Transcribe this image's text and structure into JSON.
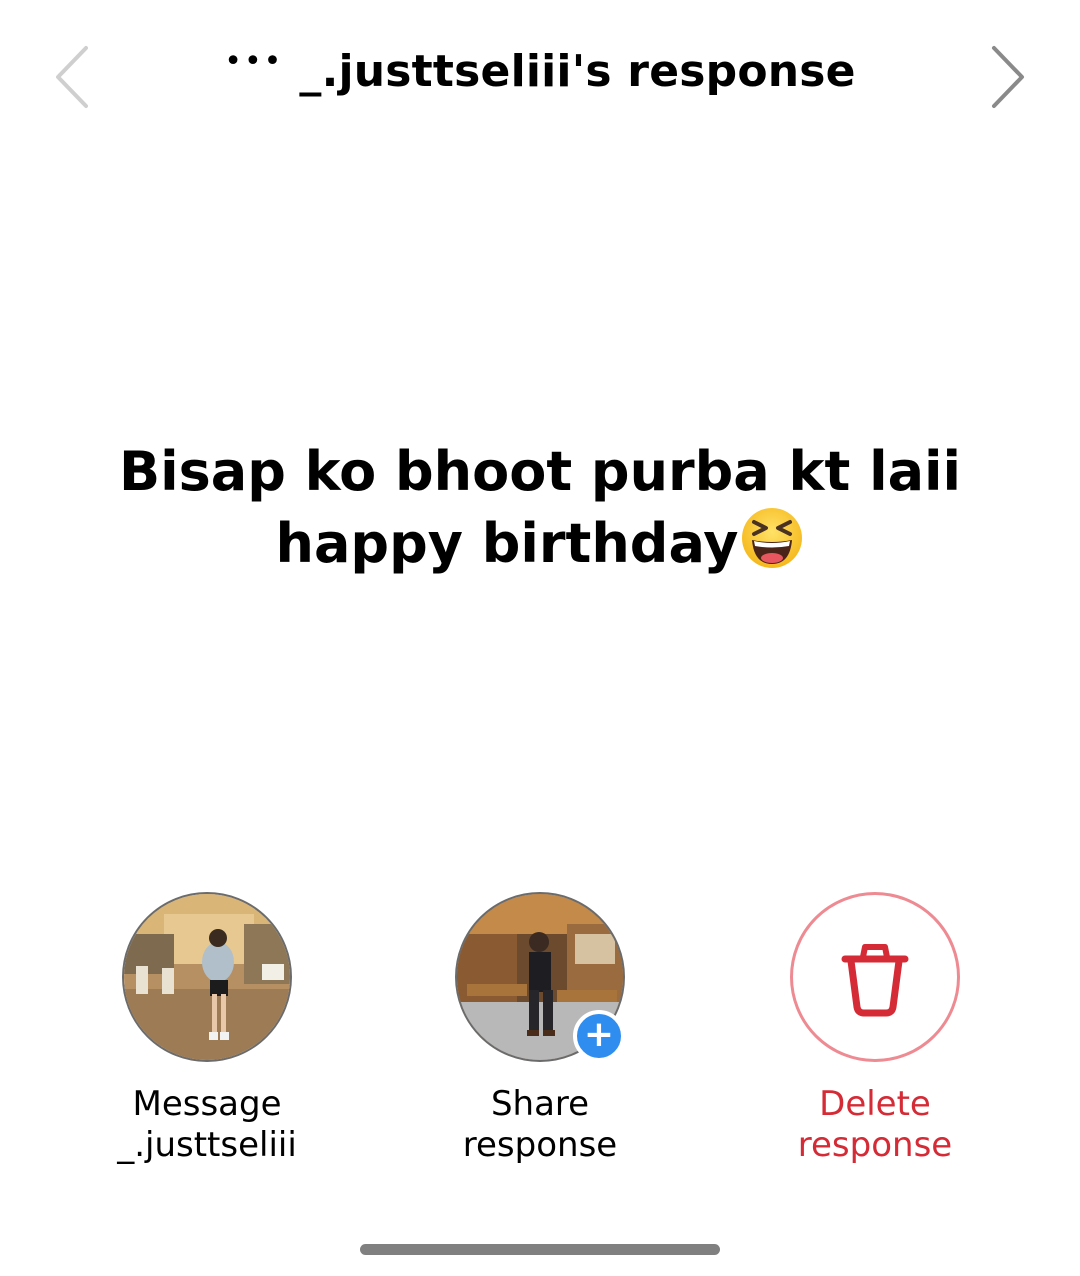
{
  "header": {
    "title": "_.justtseliii's response",
    "more_icon": "more-icon",
    "prev_icon": "chevron-left-icon",
    "next_icon": "chevron-right-icon"
  },
  "response": {
    "text": "Bisap ko bhoot purba kt laii happy birthday",
    "emoji": "laughing-squinting-face"
  },
  "actions": [
    {
      "line1": "Message",
      "line2": "_.justtseliii",
      "icon": "avatar"
    },
    {
      "line1": "Share",
      "line2": "response",
      "icon": "avatar-with-plus"
    },
    {
      "line1": "Delete",
      "line2": "response",
      "icon": "trash-icon"
    }
  ],
  "colors": {
    "delete_red": "#d42b36",
    "delete_ring": "#ee8a92",
    "plus_badge": "#2f8df0",
    "nav_arrow_disabled": "#cfcfcf",
    "nav_arrow_enabled": "#8a8a8a"
  }
}
